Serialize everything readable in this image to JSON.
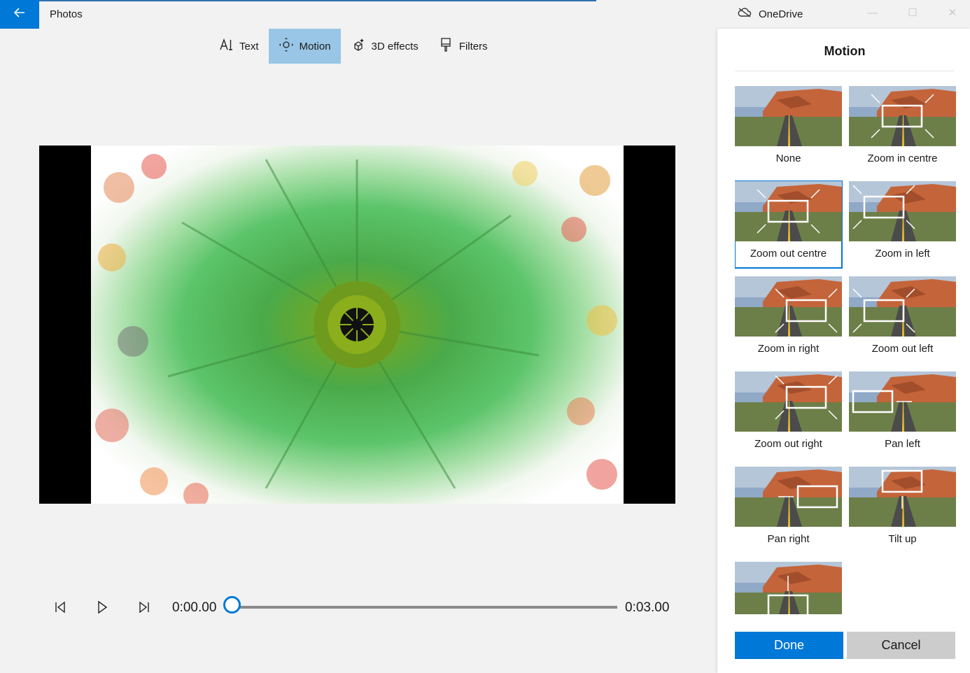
{
  "app": {
    "title": "Photos",
    "back_icon": "arrow-left-icon"
  },
  "cloud": {
    "label": "OneDrive",
    "icon": "cloud-offline-icon"
  },
  "toolbar": {
    "items": [
      {
        "label": "Text",
        "icon": "text-icon"
      },
      {
        "label": "Motion",
        "icon": "motion-icon",
        "active": true
      },
      {
        "label": "3D effects",
        "icon": "3d-effects-icon"
      },
      {
        "label": "Filters",
        "icon": "filters-icon"
      }
    ]
  },
  "player": {
    "current_time": "0:00.00",
    "total_time": "0:03.00",
    "progress": 0
  },
  "panel": {
    "title": "Motion",
    "options": [
      {
        "label": "None"
      },
      {
        "label": "Zoom in centre"
      },
      {
        "label": "Zoom out centre",
        "selected": true
      },
      {
        "label": "Zoom in left"
      },
      {
        "label": "Zoom in right"
      },
      {
        "label": "Zoom out left"
      },
      {
        "label": "Zoom out right"
      },
      {
        "label": "Pan left"
      },
      {
        "label": "Pan right"
      },
      {
        "label": "Tilt up"
      },
      {
        "label": ""
      }
    ],
    "done_label": "Done",
    "cancel_label": "Cancel"
  },
  "colors": {
    "accent": "#0078d7",
    "active_tab": "#99c6e6"
  }
}
